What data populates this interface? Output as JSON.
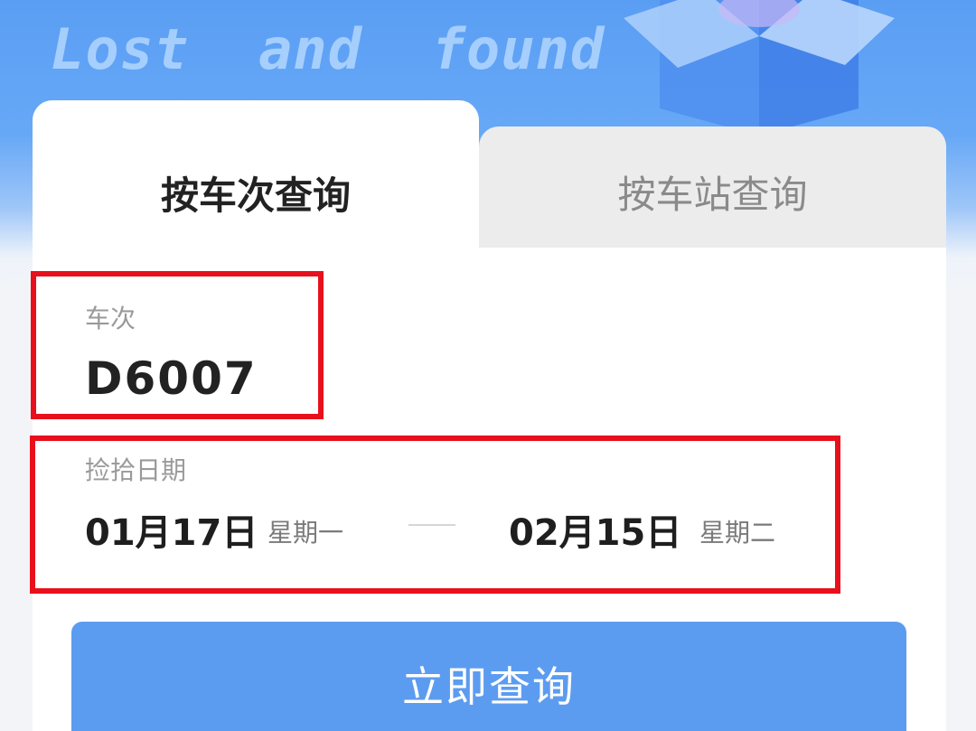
{
  "hero": {
    "title": "Lost  and  found"
  },
  "tabs": {
    "by_train": "按车次查询",
    "by_station": "按车站查询"
  },
  "train_field": {
    "label": "车次",
    "value": "D6007"
  },
  "date_field": {
    "label": "捡拾日期",
    "start_date": "01月17日",
    "start_weekday": "星期一",
    "end_date": "02月15日",
    "end_weekday": "星期二"
  },
  "actions": {
    "query_label": "立即查询"
  },
  "colors": {
    "accent": "#5c9cf0",
    "highlight_border": "#e8101c",
    "hero_bg": "#5a9ef4"
  }
}
